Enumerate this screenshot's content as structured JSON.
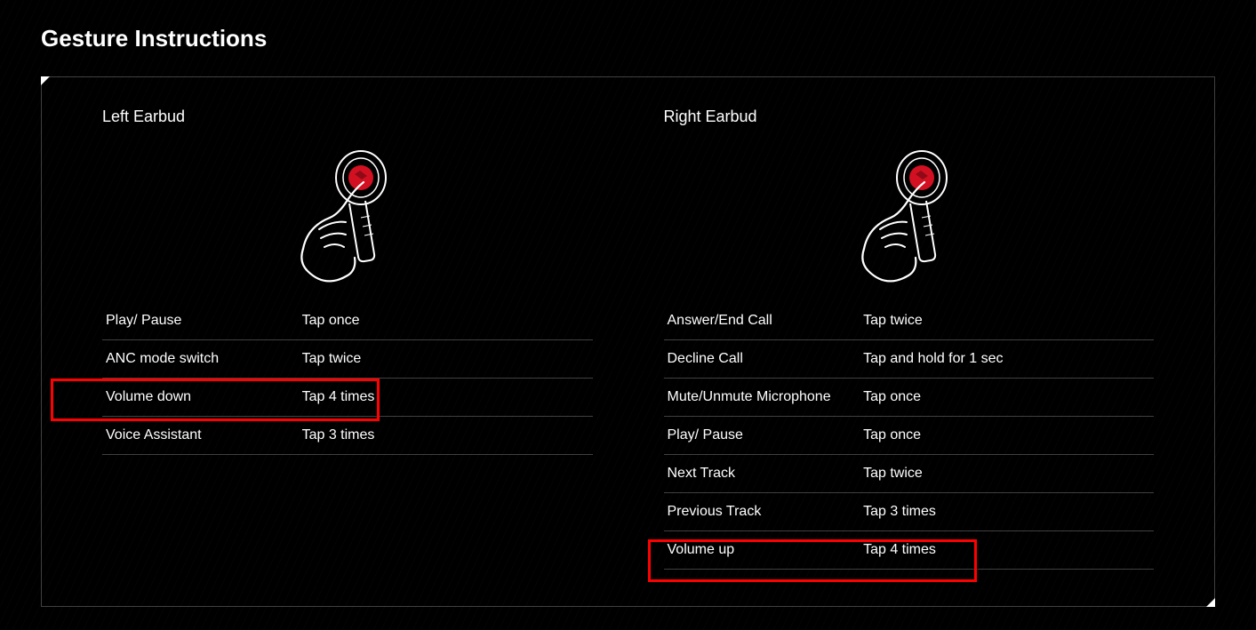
{
  "title": "Gesture Instructions",
  "left": {
    "heading": "Left Earbud",
    "rows": [
      {
        "action": "Play/ Pause",
        "gesture": "Tap once"
      },
      {
        "action": "ANC mode switch",
        "gesture": "Tap twice"
      },
      {
        "action": "Volume down",
        "gesture": "Tap 4 times"
      },
      {
        "action": "Voice Assistant",
        "gesture": "Tap 3 times"
      }
    ]
  },
  "right": {
    "heading": "Right Earbud",
    "rows": [
      {
        "action": "Answer/End Call",
        "gesture": "Tap twice"
      },
      {
        "action": "Decline Call",
        "gesture": "Tap and hold for 1 sec"
      },
      {
        "action": "Mute/Unmute Microphone",
        "gesture": "Tap once"
      },
      {
        "action": "Play/ Pause",
        "gesture": "Tap once"
      },
      {
        "action": "Next Track",
        "gesture": "Tap twice"
      },
      {
        "action": "Previous Track",
        "gesture": "Tap 3 times"
      },
      {
        "action": "Volume up",
        "gesture": "Tap 4 times"
      }
    ]
  },
  "highlights": {
    "left_row_index": 2,
    "right_row_index": 6
  },
  "colors": {
    "accent": "#d31021",
    "highlight_border": "#ff0000"
  }
}
